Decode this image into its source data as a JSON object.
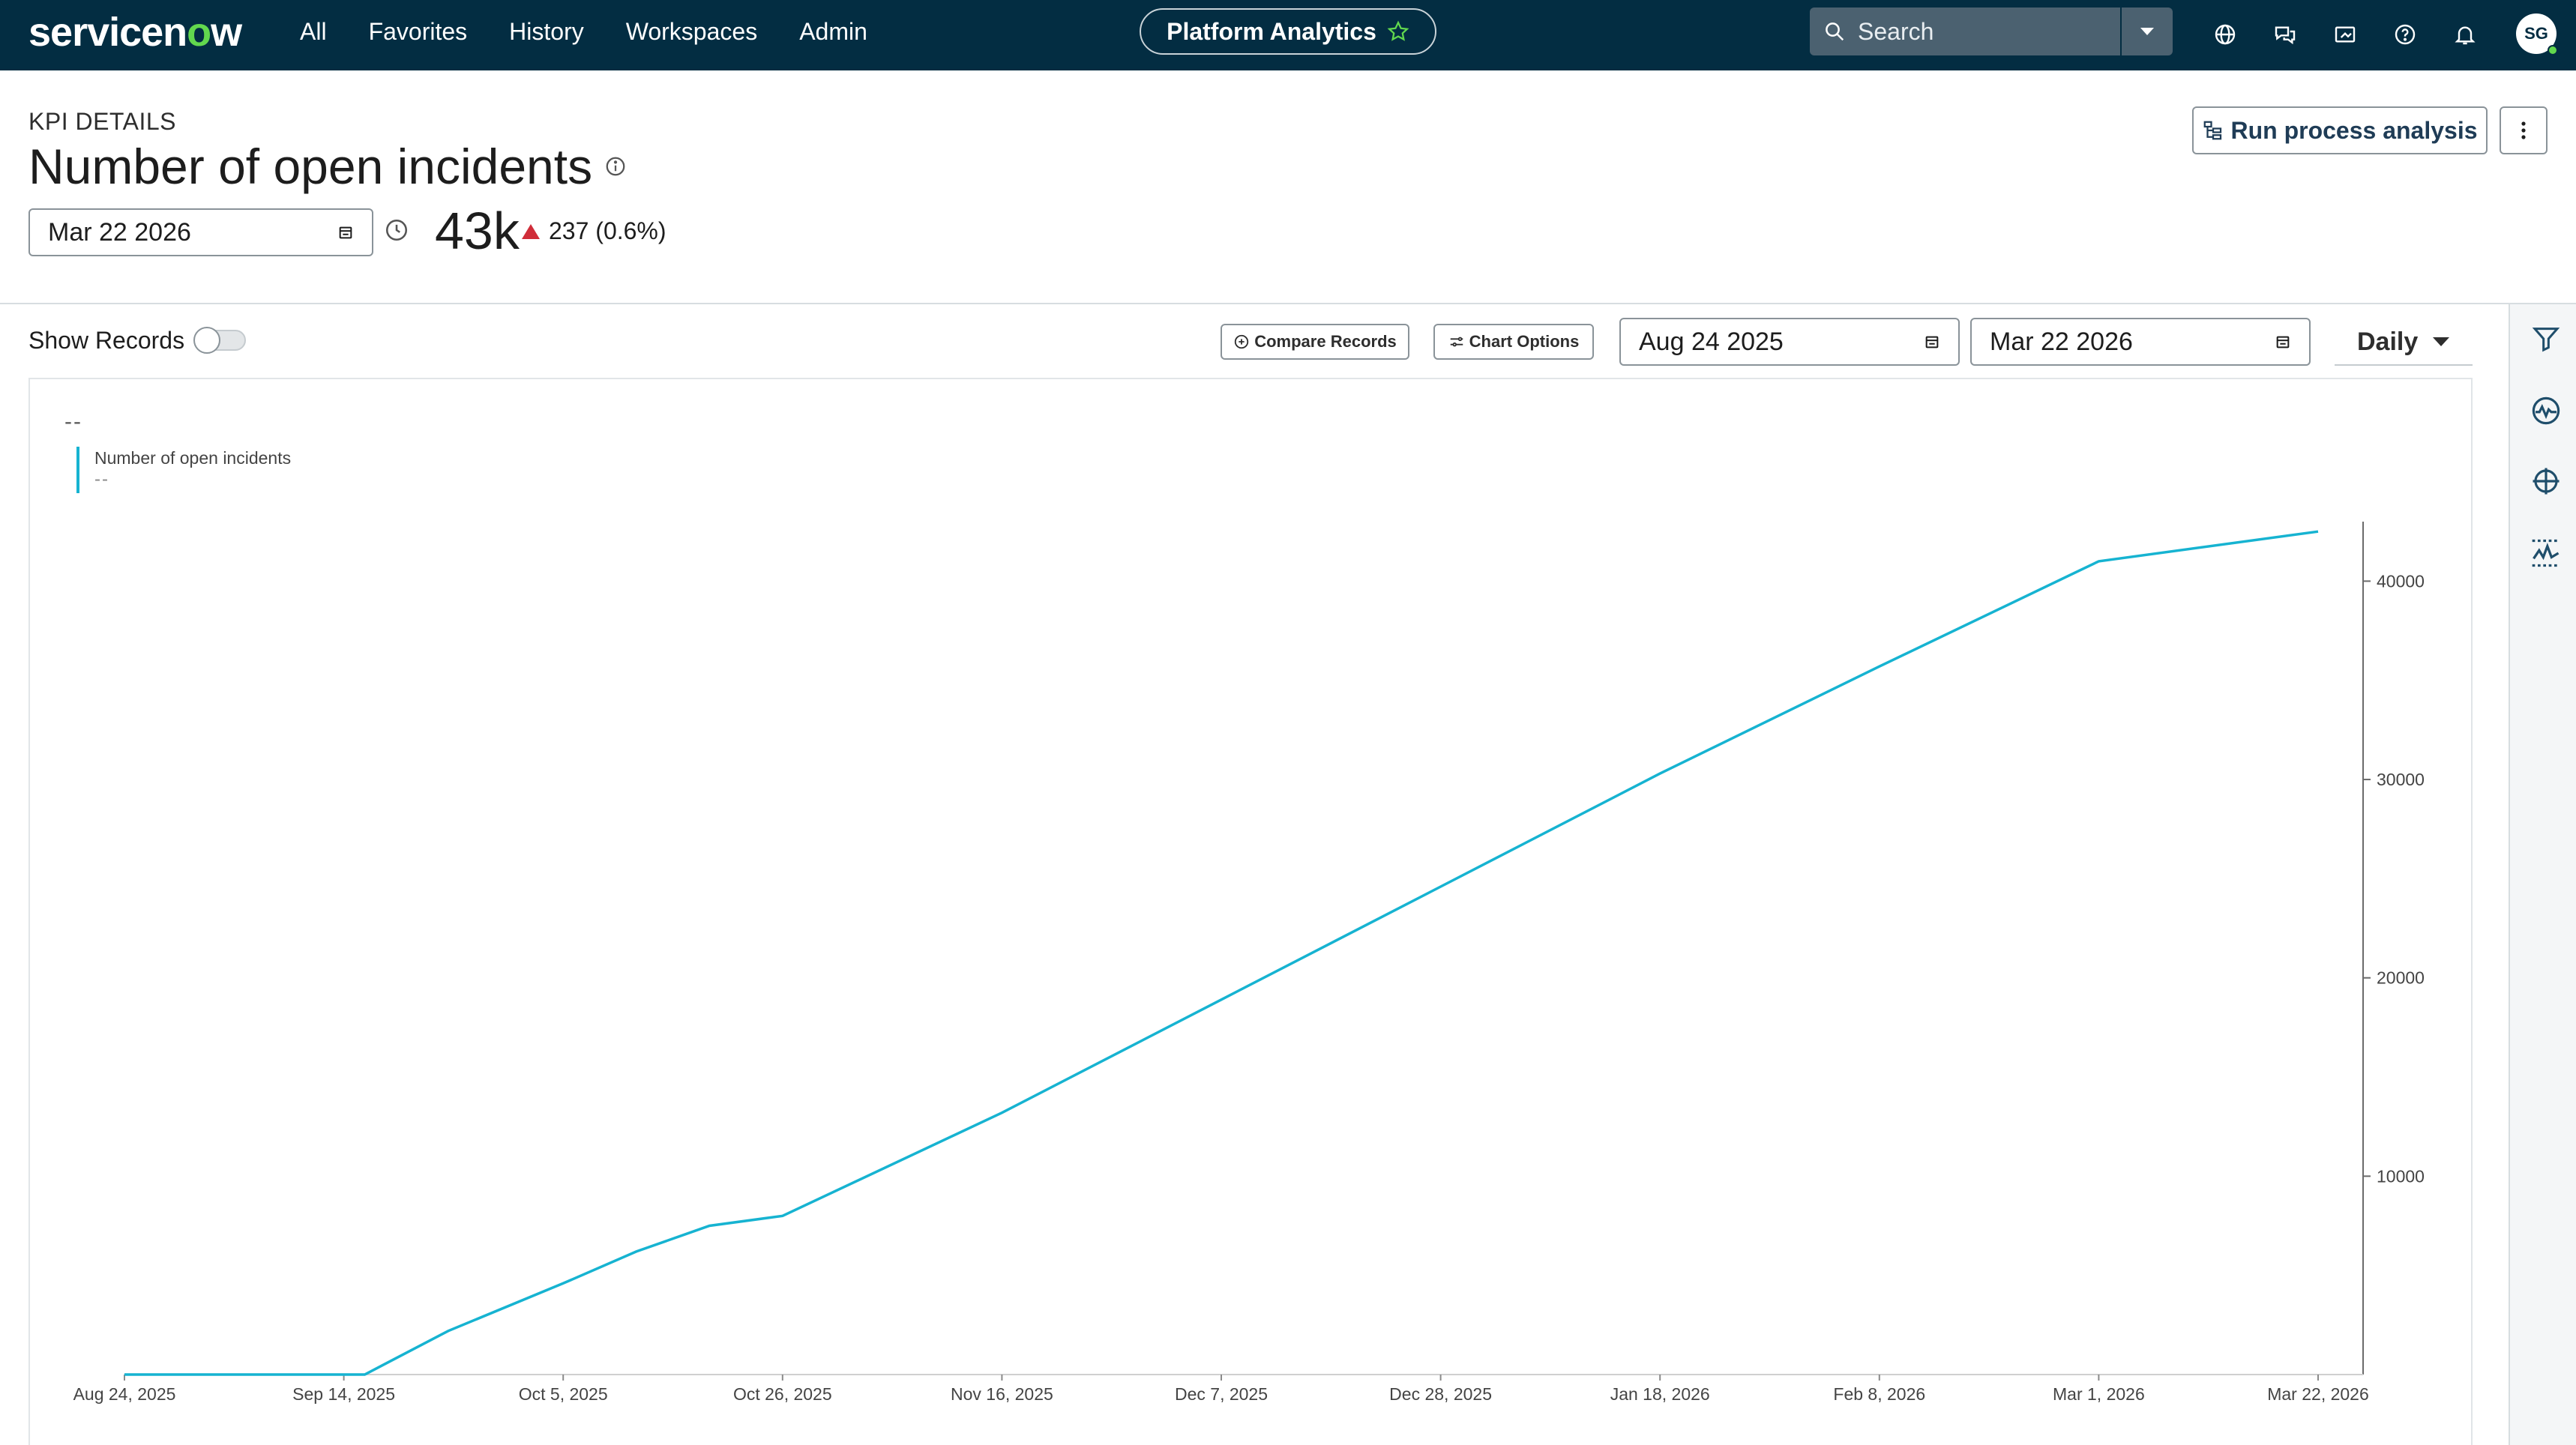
{
  "nav": {
    "logo_left": "servicen",
    "logo_o": "o",
    "logo_right": "w",
    "links": [
      "All",
      "Favorites",
      "History",
      "Workspaces",
      "Admin"
    ],
    "workspace_pill": "Platform Analytics",
    "search_placeholder": "Search",
    "icons": [
      "globe-icon",
      "chat-icon",
      "media-icon",
      "help-icon",
      "bell-icon"
    ],
    "avatar_initials": "SG"
  },
  "header": {
    "kpi_label": "KPI DETAILS",
    "title": "Number of open incidents",
    "date": "Mar 22 2026",
    "kpi_value": "43k",
    "kpi_change": "237 (0.6%)",
    "run_button": "Run process analysis"
  },
  "toolbar": {
    "show_records": "Show Records",
    "show_records_on": false,
    "compare_records": "Compare Records",
    "chart_options": "Chart Options",
    "date_from": "Aug 24 2025",
    "date_to": "Mar 22 2026",
    "frequency": "Daily"
  },
  "chart": {
    "header_dash": "--",
    "legend_name": "Number of open incidents",
    "legend_value": "--"
  },
  "chart_data": {
    "type": "line",
    "series": [
      {
        "name": "Number of open incidents",
        "color": "#16b3d1",
        "points": [
          [
            "2025-08-24",
            0
          ],
          [
            "2025-09-16",
            0
          ],
          [
            "2025-09-24",
            2200
          ],
          [
            "2025-10-05",
            4600
          ],
          [
            "2025-10-12",
            6200
          ],
          [
            "2025-10-19",
            7500
          ],
          [
            "2025-10-26",
            8000
          ],
          [
            "2025-11-16",
            13200
          ],
          [
            "2025-12-07",
            18900
          ],
          [
            "2025-12-28",
            24600
          ],
          [
            "2026-01-18",
            30300
          ],
          [
            "2026-02-08",
            35700
          ],
          [
            "2026-03-01",
            41000
          ],
          [
            "2026-03-22",
            42500
          ]
        ]
      }
    ],
    "x_ticks": [
      "Aug 24, 2025",
      "Sep 14, 2025",
      "Oct 5, 2025",
      "Oct 26, 2025",
      "Nov 16, 2025",
      "Dec 7, 2025",
      "Dec 28, 2025",
      "Jan 18, 2026",
      "Feb 8, 2026",
      "Mar 1, 2026",
      "Mar 22, 2026"
    ],
    "x_tick_dates": [
      "2025-08-24",
      "2025-09-14",
      "2025-10-05",
      "2025-10-26",
      "2025-11-16",
      "2025-12-07",
      "2025-12-28",
      "2026-01-18",
      "2026-02-08",
      "2026-03-01",
      "2026-03-22"
    ],
    "y_ticks": [
      10000,
      20000,
      30000,
      40000
    ],
    "ylim": [
      0,
      43000
    ],
    "y_axis_side": "right",
    "grid": false
  }
}
